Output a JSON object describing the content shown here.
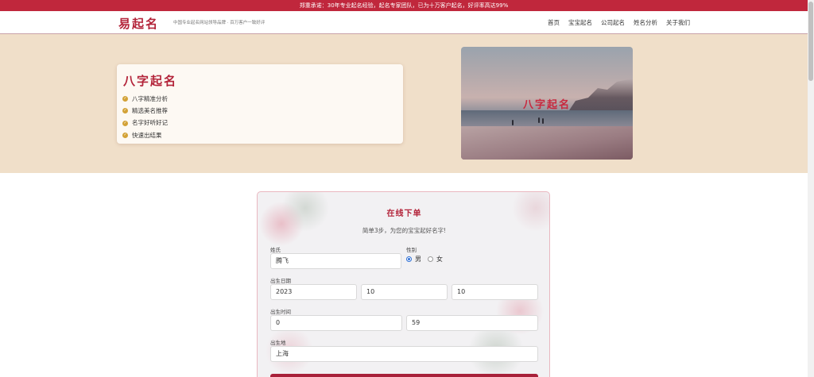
{
  "topbar": {
    "text": "郑重承诺：30年专业起名经验，起名专家团队，已为十万客户起名，好评率高达99%"
  },
  "nav": {
    "logo": "易起名",
    "slogan": "中国专业起名网站领导品牌 · 百万客户一致好评",
    "menu": [
      "首页",
      "宝宝起名",
      "公司起名",
      "姓名分析",
      "关于我们"
    ]
  },
  "hero": {
    "title": "八字起名",
    "features": [
      "八字精准分析",
      "精选美名推荐",
      "名字好听好记",
      "快速出结果"
    ],
    "image_text": "八字起名"
  },
  "form": {
    "title": "在线下单",
    "subtitle": "简单3步，为您的宝宝起好名字!",
    "surname_label": "姓氏",
    "surname_value": "腾飞",
    "gender_label": "性别",
    "gender_options": [
      "男",
      "女"
    ],
    "gender_selected": "男",
    "birth_date_label": "出生日期",
    "birth_year": "2023",
    "birth_month": "10",
    "birth_day": "10",
    "birth_time_label": "出生时间",
    "birth_hour": "0",
    "birth_minute": "59",
    "birthplace_label": "出生地",
    "birthplace_value": "上海"
  },
  "colors": {
    "brand": "#c0273c",
    "hero_bg": "#f0dfc9",
    "check": "#d3a236"
  },
  "icons": {
    "feature_bullet": "check-circle-icon"
  }
}
